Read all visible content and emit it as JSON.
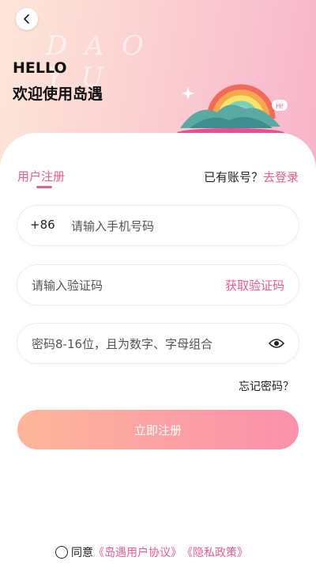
{
  "header": {
    "watermark": "DAO YU",
    "hello": "HELLO",
    "welcome": "欢迎使用岛遇",
    "back_icon": "chevron-left-icon"
  },
  "tabs": {
    "register": "用户注册",
    "has_account": "已有账号？",
    "login_link": "去登录"
  },
  "form": {
    "phone_prefix": "+86",
    "phone_placeholder": "请输入手机号码",
    "code_placeholder": "请输入验证码",
    "get_code_label": "获取验证码",
    "password_placeholder": "密码8-16位，且为数字、字母组合",
    "eye_icon": "eye-icon",
    "forgot_label": "忘记密码？",
    "submit_label": "立即注册"
  },
  "agreement": {
    "prefix": "同意",
    "user_agreement": "《岛遇用户协议》",
    "privacy_policy": "《隐私政策》"
  },
  "colors": {
    "accent": "#ef5d8c",
    "button_start": "#fdb79a",
    "button_end": "#fb91ad"
  }
}
